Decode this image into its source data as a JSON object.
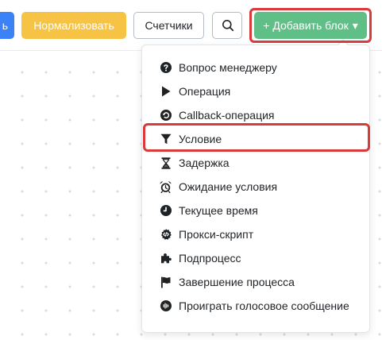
{
  "toolbar": {
    "partial_button_label": "ь",
    "normalize_label": "Нормализовать",
    "counters_label": "Счетчики",
    "add_block_label": "Добавить блок",
    "add_block_plus": "+",
    "add_block_caret": "▾"
  },
  "dropdown": {
    "items": [
      {
        "label": "Вопрос менеджеру",
        "icon": "question-circle-icon"
      },
      {
        "label": "Операция",
        "icon": "play-icon"
      },
      {
        "label": "Callback-операция",
        "icon": "callback-icon"
      },
      {
        "label": "Условие",
        "icon": "filter-icon"
      },
      {
        "label": "Задержка",
        "icon": "hourglass-icon"
      },
      {
        "label": "Ожидание условия",
        "icon": "alarm-clock-icon"
      },
      {
        "label": "Текущее время",
        "icon": "clock-icon"
      },
      {
        "label": "Прокси-скрипт",
        "icon": "code-icon"
      },
      {
        "label": "Подпроцесс",
        "icon": "puzzle-icon"
      },
      {
        "label": "Завершение процесса",
        "icon": "flag-icon"
      },
      {
        "label": "Проиграть голосовое сообщение",
        "icon": "voice-icon"
      }
    ]
  },
  "colors": {
    "blue": "#3b82f6",
    "yellow": "#f6c344",
    "green": "#5fbf86",
    "highlight": "#d93a3a"
  }
}
